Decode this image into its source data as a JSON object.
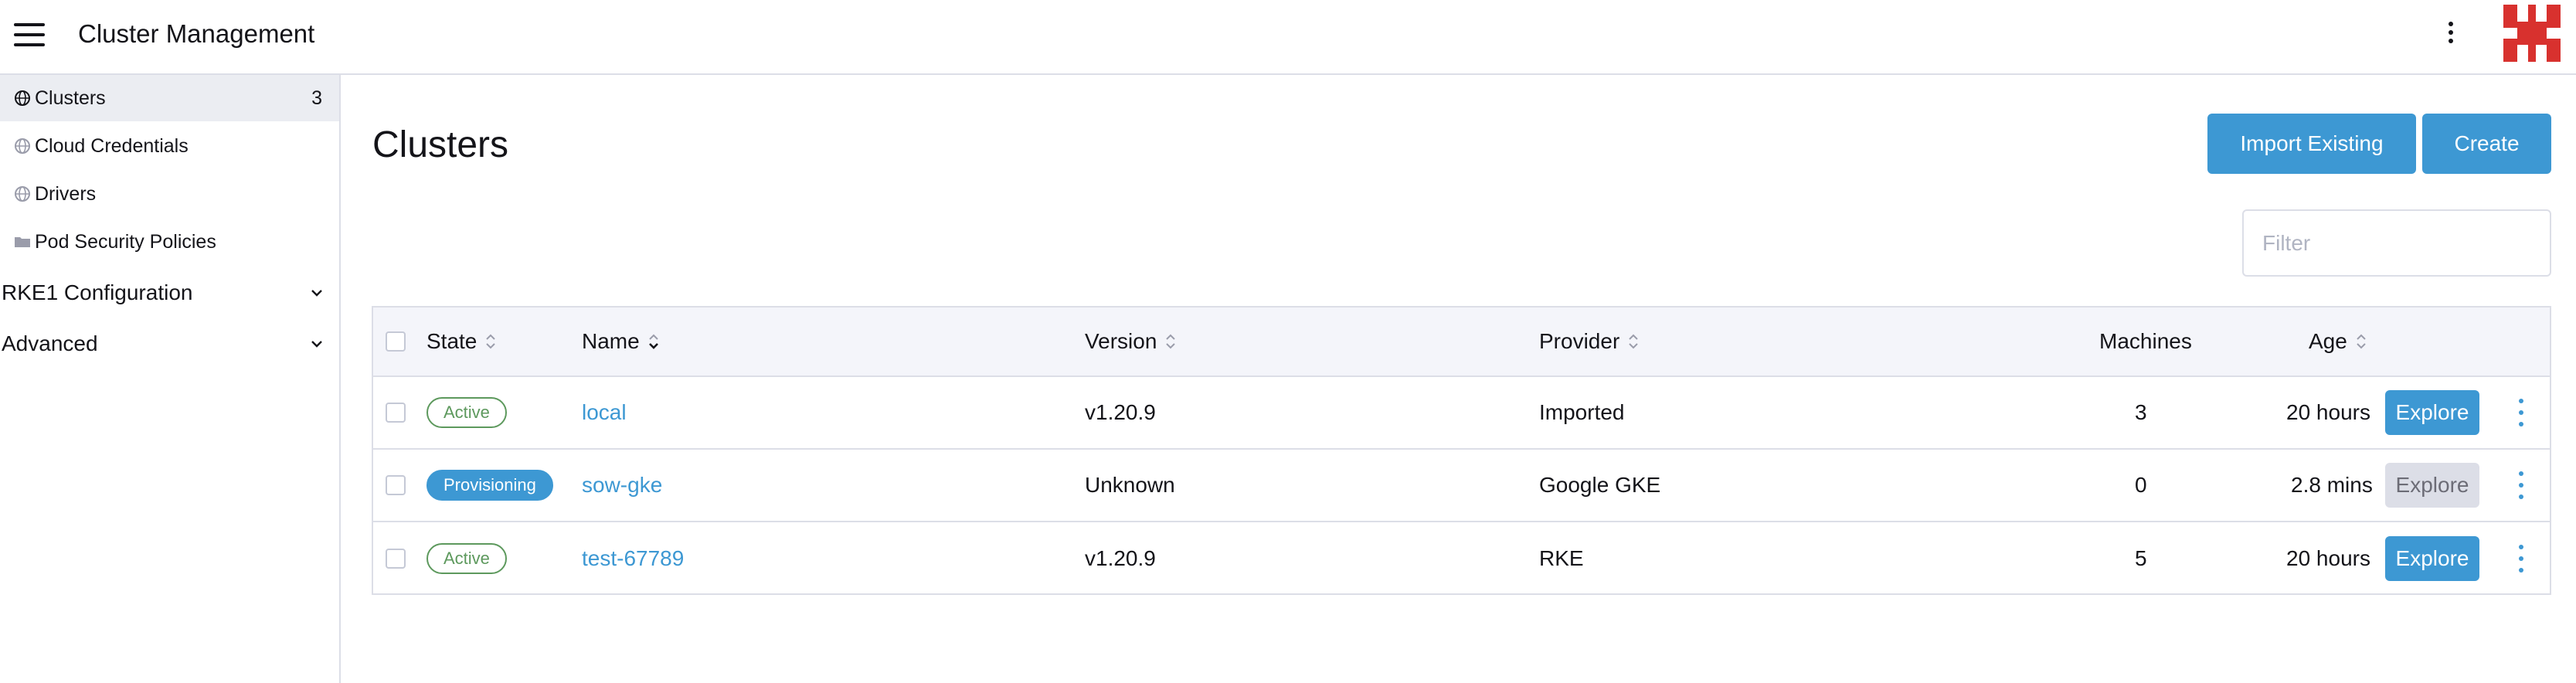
{
  "header": {
    "title": "Cluster Management",
    "menu_icon": "hamburger-icon",
    "more_icon": "kebab-icon",
    "logo_icon": "rancher-logo",
    "logo_color": "#d8312e"
  },
  "sidebar": {
    "items": [
      {
        "label": "Clusters",
        "count": "3",
        "icon": "globe-icon",
        "active": true
      },
      {
        "label": "Cloud Credentials",
        "icon": "globe-icon"
      },
      {
        "label": "Drivers",
        "icon": "globe-icon"
      },
      {
        "label": "Pod Security Policies",
        "icon": "folder-icon"
      }
    ],
    "groups": [
      {
        "label": "RKE1 Configuration",
        "icon": "chevron-down-icon"
      },
      {
        "label": "Advanced",
        "icon": "chevron-down-icon"
      }
    ]
  },
  "main": {
    "title": "Clusters",
    "import_label": "Import Existing",
    "create_label": "Create",
    "filter_placeholder": "Filter"
  },
  "table": {
    "headers": {
      "state": "State",
      "name": "Name",
      "version": "Version",
      "provider": "Provider",
      "machines": "Machines",
      "age": "Age"
    },
    "rows": [
      {
        "state": "Active",
        "name": "local",
        "version": "v1.20.9",
        "provider": "Imported",
        "machines": "3",
        "age": "20 hours",
        "explore": "Explore",
        "explore_enabled": true
      },
      {
        "state": "Provisioning",
        "name": "sow-gke",
        "version": "Unknown",
        "provider": "Google GKE",
        "machines": "0",
        "age": "2.8 mins",
        "explore": "Explore",
        "explore_enabled": false
      },
      {
        "state": "Active",
        "name": "test-67789",
        "version": "v1.20.9",
        "provider": "RKE",
        "machines": "5",
        "age": "20 hours",
        "explore": "Explore",
        "explore_enabled": true
      }
    ]
  },
  "colors": {
    "accent": "#3d98d3",
    "active_badge": "#5d995d",
    "border": "#dcdee7",
    "header_bg": "#f4f5fa"
  }
}
